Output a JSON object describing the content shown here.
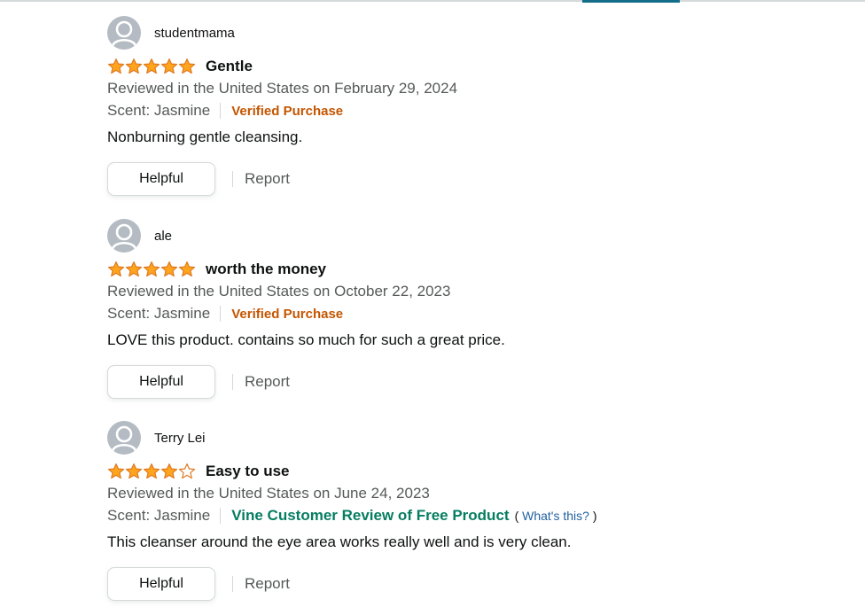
{
  "colors": {
    "star_fill": "#ffa41c",
    "star_outline": "#de7921",
    "verified": "#c45500",
    "vine": "#067d62",
    "link": "#2162a1",
    "secondary_text": "#565959"
  },
  "reviews": [
    {
      "author": "studentmama",
      "rating": 5,
      "rating_max": 5,
      "title": "Gentle",
      "date": "Reviewed in the United States on February 29, 2024",
      "variant": "Scent: Jasmine",
      "badge": "Verified Purchase",
      "body": "Nonburning gentle cleansing.",
      "helpful_label": "Helpful",
      "report_label": "Report"
    },
    {
      "author": "ale",
      "rating": 5,
      "rating_max": 5,
      "title": "worth the money",
      "date": "Reviewed in the United States on October 22, 2023",
      "variant": "Scent: Jasmine",
      "badge": "Verified Purchase",
      "body": "LOVE this product. contains so much for such a great price.",
      "helpful_label": "Helpful",
      "report_label": "Report"
    },
    {
      "author": "Terry Lei",
      "rating": 4,
      "rating_max": 5,
      "title": "Easy to use",
      "date": "Reviewed in the United States on June 24, 2023",
      "variant": "Scent: Jasmine",
      "badge": "Vine Customer Review of Free Product",
      "badge_open": "(",
      "badge_link": "What's this?",
      "badge_close": ")",
      "body": "This cleanser around the eye area works really well and is very clean.",
      "helpful_label": "Helpful",
      "report_label": "Report"
    }
  ]
}
